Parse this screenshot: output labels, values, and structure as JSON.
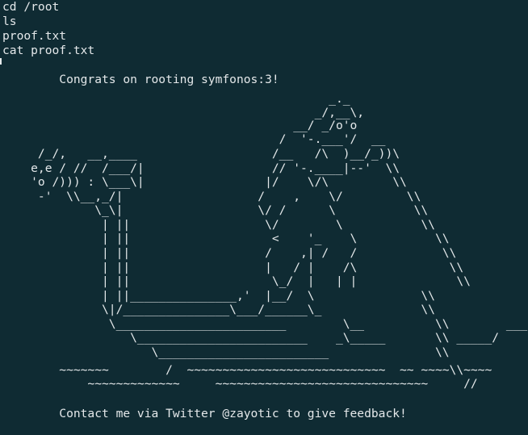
{
  "terminal": {
    "lines": [
      "cd /root",
      "ls",
      "proof.txt",
      "cat proof.txt",
      "",
      "        Congrats on rooting symfonos:3!",
      "                                              _._",
      "                                            _/,__\\,",
      "                                         __/ _/o'o",
      "                                       /  '-.___'/  __",
      "     /_/,   __,____                   /__   /\\  )__/_))\\",
      "    e,e / //  /___/|                  // '-.____|--'  \\\\",
      "    'o /))) : \\___\\|                 |/    \\/\\         \\\\",
      "     -'  \\\\__,_/|                   /    ,    \\/         \\\\",
      "             \\_\\|                   \\/ /      \\           \\\\",
      "              | ||                   \\/        \\           \\\\",
      "              | ||                    <    '_    \\           \\\\",
      "              | ||                   /    ,| /   /            \\\\",
      "              | ||                   |   / |    /\\             \\\\",
      "              | ||                    \\_/  |   | |              \\\\",
      "              | ||_______________,'  |__/  \\               \\\\",
      "              \\|/_______________\\___/______\\_              \\\\",
      "               \\________________________        \\__          \\\\        ___",
      "                  \\________________________    _\\_____       \\\\ _____/",
      "                     \\________________________               \\\\",
      "        ~~~~~~~        /  ~~~~~~~~~~~~~~~~~~~~~~~~~~~~  ~~ ~~~~\\\\~~~~",
      "            ~~~~~~~~~~~~~     ~~~~~~~~~~~~~~~~~~~~~~~~~~~~~~     //",
      "",
      "        Contact me via Twitter @zayotic to give feedback!"
    ]
  }
}
